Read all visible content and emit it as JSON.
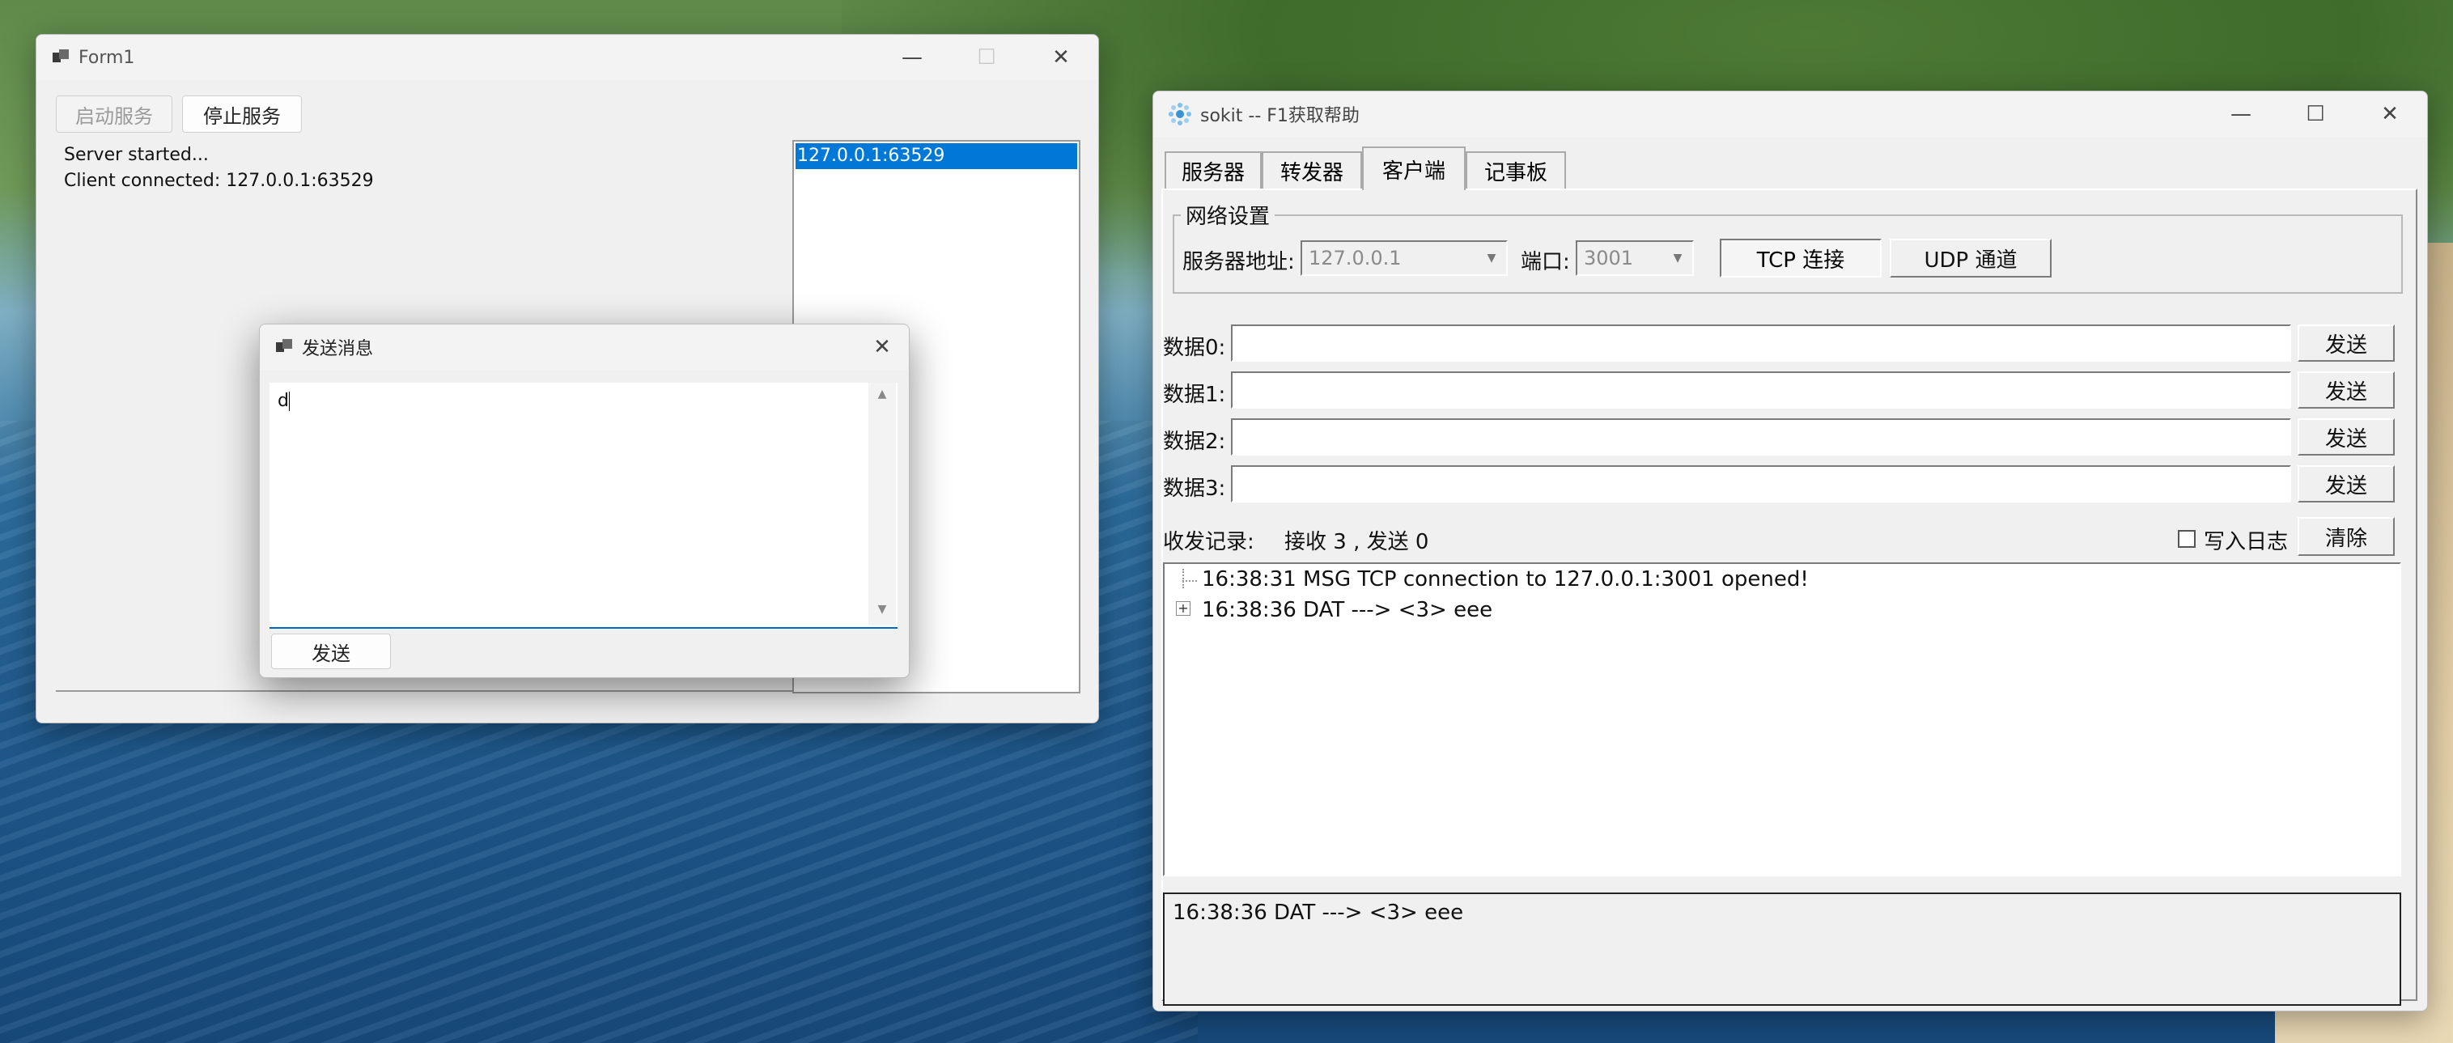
{
  "form1": {
    "title": "Form1",
    "start_label": "启动服务",
    "stop_label": "停止服务",
    "log_lines": [
      "Server started...",
      "Client connected: 127.0.0.1:63529"
    ],
    "clients": [
      "127.0.0.1:63529"
    ]
  },
  "send_dialog": {
    "title": "发送消息",
    "message_value": "d",
    "send_label": "发送"
  },
  "sokit": {
    "title": "sokit -- F1获取帮助",
    "tabs": [
      "服务器",
      "转发器",
      "客户端",
      "记事板"
    ],
    "active_tab": "客户端",
    "group_title": "网络设置",
    "server_addr_label": "服务器地址:",
    "server_addr_value": "127.0.0.1",
    "port_label": "端口:",
    "port_value": "3001",
    "tcp_label": "TCP 连接",
    "udp_label": "UDP 通道",
    "data_rows": [
      {
        "label": "数据0:",
        "value": "",
        "send": "发送"
      },
      {
        "label": "数据1:",
        "value": "",
        "send": "发送"
      },
      {
        "label": "数据2:",
        "value": "",
        "send": "发送"
      },
      {
        "label": "数据3:",
        "value": "",
        "send": "发送"
      }
    ],
    "record_label": "收发记录:",
    "record_stats": "接收 3 , 发送 0",
    "write_log_label": "写入日志",
    "write_log_checked": false,
    "clear_label": "清除",
    "tree": [
      "16:38:31 MSG TCP connection to 127.0.0.1:3001 opened!",
      "16:38:36 DAT ---> <3> eee"
    ],
    "detail_text": "16:38:36 DAT ---> <3> eee"
  }
}
